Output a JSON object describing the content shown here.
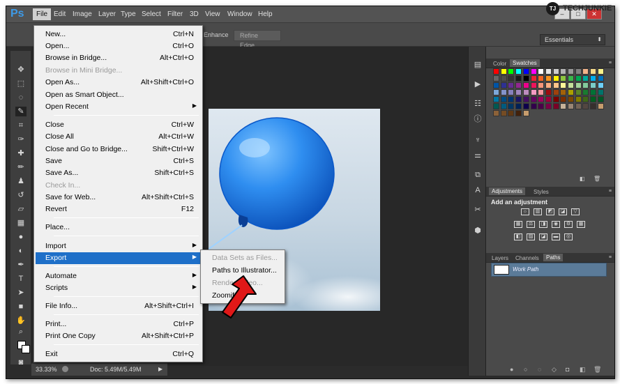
{
  "app": {
    "logo": "Ps"
  },
  "menubar": {
    "items": [
      "File",
      "Edit",
      "Image",
      "Layer",
      "Type",
      "Select",
      "Filter",
      "3D",
      "View",
      "Window",
      "Help"
    ],
    "window_controls": [
      "–",
      "□",
      "✕"
    ]
  },
  "options_bar": {
    "enhance_label": "Enhance",
    "refine_edge_label": "Refine Edge...",
    "workspace_value": "Essentials"
  },
  "file_menu": {
    "items": [
      {
        "label": "New...",
        "shortcut": "Ctrl+N"
      },
      {
        "label": "Open...",
        "shortcut": "Ctrl+O"
      },
      {
        "label": "Browse in Bridge...",
        "shortcut": "Alt+Ctrl+O"
      },
      {
        "label": "Browse in Mini Bridge...",
        "shortcut": ""
      },
      {
        "label": "Open As...",
        "shortcut": "Alt+Shift+Ctrl+O"
      },
      {
        "label": "Open as Smart Object...",
        "shortcut": ""
      },
      {
        "label": "Open Recent",
        "shortcut": ""
      },
      {
        "label": "Close",
        "shortcut": "Ctrl+W"
      },
      {
        "label": "Close All",
        "shortcut": "Alt+Ctrl+W"
      },
      {
        "label": "Close and Go to Bridge...",
        "shortcut": "Shift+Ctrl+W"
      },
      {
        "label": "Save",
        "shortcut": "Ctrl+S"
      },
      {
        "label": "Save As...",
        "shortcut": "Shift+Ctrl+S"
      },
      {
        "label": "Check In...",
        "shortcut": ""
      },
      {
        "label": "Save for Web...",
        "shortcut": "Alt+Shift+Ctrl+S"
      },
      {
        "label": "Revert",
        "shortcut": "F12"
      },
      {
        "label": "Place...",
        "shortcut": ""
      },
      {
        "label": "Import",
        "shortcut": ""
      },
      {
        "label": "Export",
        "shortcut": ""
      },
      {
        "label": "Automate",
        "shortcut": ""
      },
      {
        "label": "Scripts",
        "shortcut": ""
      },
      {
        "label": "File Info...",
        "shortcut": "Alt+Shift+Ctrl+I"
      },
      {
        "label": "Print...",
        "shortcut": "Ctrl+P"
      },
      {
        "label": "Print One Copy",
        "shortcut": "Alt+Shift+Ctrl+P"
      },
      {
        "label": "Exit",
        "shortcut": "Ctrl+Q"
      }
    ],
    "highlighted": "Export"
  },
  "export_submenu": {
    "items": [
      "Data Sets as Files...",
      "Paths to Illustrator...",
      "Render Video...",
      "Zoomify..."
    ]
  },
  "status_bar": {
    "zoom": "33.33%",
    "doc_info": "Doc: 5.49M/5.49M"
  },
  "panels": {
    "swatch_tabs": [
      "Color",
      "Swatches"
    ],
    "adjust_tabs": [
      "Adjustments",
      "Styles"
    ],
    "adjust_heading": "Add an adjustment",
    "layer_tabs": [
      "Layers",
      "Channels",
      "Paths"
    ],
    "work_path_label": "Work Path"
  },
  "watermark": {
    "badge": "TJ",
    "text": "TECHJUNKIE"
  },
  "colors": {
    "accent_highlight": "#1e6fc8",
    "workpath_selected": "#5b7b99",
    "arrow_red": "#e01818"
  }
}
